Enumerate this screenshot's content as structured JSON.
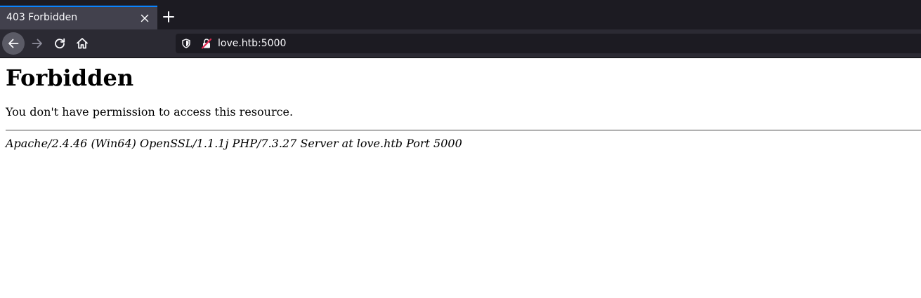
{
  "browser": {
    "tab": {
      "title": "403 Forbidden",
      "close_icon": "close-icon"
    },
    "new_tab_icon": "plus-icon",
    "toolbar": {
      "back_icon": "arrow-left-icon",
      "forward_icon": "arrow-right-icon",
      "reload_icon": "reload-icon",
      "home_icon": "home-icon"
    },
    "urlbar": {
      "url": "love.htb:5000",
      "tracking_icon": "shield-icon",
      "security_icon": "insecure-lock-icon"
    },
    "colors": {
      "tabstrip_bg": "#1c1b22",
      "active_tab_bg": "#42414d",
      "tab_accent": "#0a84ff",
      "toolbar_bg": "#2b2a33",
      "insecure_accent": "#e22850"
    }
  },
  "page": {
    "title": "Forbidden",
    "message": "You don't have permission to access this resource.",
    "signature": "Apache/2.4.46 (Win64) OpenSSL/1.1.1j PHP/7.3.27 Server at love.htb Port 5000"
  }
}
